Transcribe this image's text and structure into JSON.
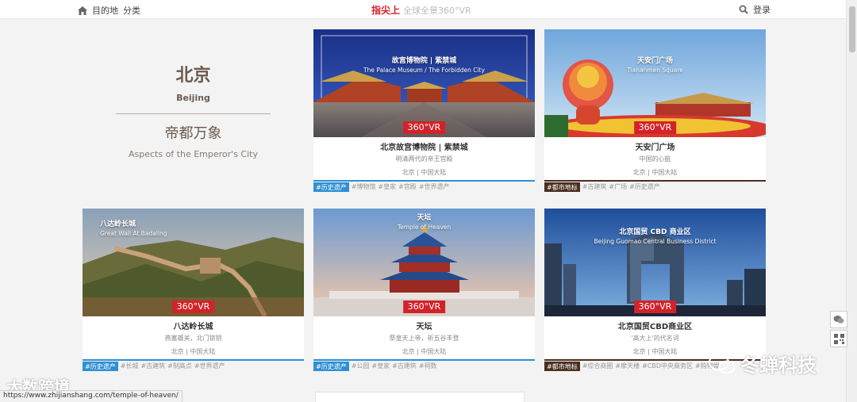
{
  "nav": {
    "destination": "目的地",
    "category": "分类",
    "brand_main": "指尖上",
    "brand_sub": "全球全景360°VR",
    "login": "登录"
  },
  "intro": {
    "city_cn": "北京",
    "city_en": "Beijing",
    "slogan_cn": "帝都万象",
    "slogan_en": "Aspects of the Emperor's City"
  },
  "vr_label": "360°VR",
  "cards": [
    {
      "photo_title_cn": "故宫博物院 | 紫禁城",
      "photo_title_en": "The Palace Museum / The Forbidden City",
      "name": "北京故宫博物院 | 紫禁城",
      "desc": "明清两代的帝王宫殿",
      "location": "北京 | 中国大陆",
      "category": "#历史遗产",
      "category_color": "#2f8fd3",
      "tags": [
        "#博物馆",
        "#皇家",
        "#宫殿",
        "#世界遗产"
      ]
    },
    {
      "photo_title_cn": "天安门广场",
      "photo_title_en": "Tiananmen Square",
      "name": "天安门广场",
      "desc": "中国的心脏",
      "location": "北京 | 中国大陆",
      "category": "#都市地标",
      "category_color": "#4a2e20",
      "tags": [
        "#古建筑",
        "#广场",
        "#历史遗产"
      ]
    },
    {
      "photo_title_cn": "八达岭长城",
      "photo_title_en": "Great Wall At Badaling",
      "name": "八达岭长城",
      "desc": "燕塞雄关，北门锁钥",
      "location": "北京 | 中国大陆",
      "category": "#历史遗产",
      "category_color": "#2f8fd3",
      "tags": [
        "#长城",
        "#古建筑",
        "#制高点",
        "#世界遗产"
      ]
    },
    {
      "photo_title_cn": "天坛",
      "photo_title_en": "Temple of Heaven",
      "name": "天坛",
      "desc": "祭皇天上帝，祈五谷丰登",
      "location": "北京 | 中国大陆",
      "category": "#历史遗产",
      "category_color": "#2f8fd3",
      "tags": [
        "#公园",
        "#皇家",
        "#古建筑",
        "#祠数"
      ]
    },
    {
      "photo_title_cn": "北京国贸 CBD 商业区",
      "photo_title_en": "Beijing Guomao Central Business District",
      "name": "北京国贸CBD商业区",
      "desc": "'高大上'的代名词",
      "location": "北京 | 中国大陆",
      "category": "#都市地标",
      "category_color": "#4a2e20",
      "tags": [
        "#综合商圈",
        "#摩天楼",
        "#CBD中央商务区",
        "#购物娱"
      ]
    }
  ],
  "watermark_right": "冬蝉科技",
  "watermark_left": "大数跨境",
  "status_url": "https://www.zhijianshang.com/temple-of-heaven/"
}
